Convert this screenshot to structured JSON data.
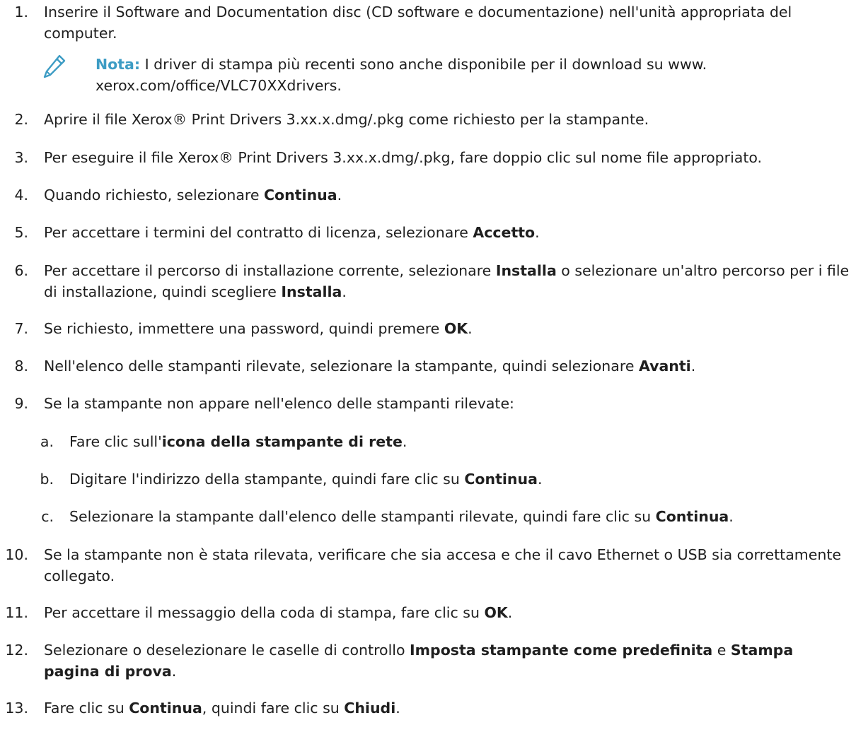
{
  "steps": [
    {
      "num": "1.",
      "text": "Inserire il Software and Documentation disc (CD software e documentazione) nell'unità appropriata del computer."
    },
    {
      "num": "2.",
      "text": "Aprire il file Xerox® Print Drivers 3.xx.x.dmg/.pkg come richiesto per la stampante."
    },
    {
      "num": "3.",
      "text": "Per eseguire il file Xerox® Print Drivers 3.xx.x.dmg/.pkg, fare doppio clic sul nome file appropriato."
    },
    {
      "num": "4.",
      "pre": "Quando richiesto, selezionare ",
      "b1": "Continua",
      "post": "."
    },
    {
      "num": "5.",
      "pre": "Per accettare i termini del contratto di licenza, selezionare ",
      "b1": "Accetto",
      "post": "."
    },
    {
      "num": "6.",
      "pre": "Per accettare il percorso di installazione corrente, selezionare ",
      "b1": "Installa",
      "mid": " o selezionare un'altro percorso per i file di installazione, quindi scegliere ",
      "b2": "Installa",
      "post": "."
    },
    {
      "num": "7.",
      "pre": "Se richiesto, immettere una password, quindi premere ",
      "b1": "OK",
      "post": "."
    },
    {
      "num": "8.",
      "pre": "Nell'elenco delle stampanti rilevate, selezionare la stampante, quindi selezionare ",
      "b1": "Avanti",
      "post": "."
    },
    {
      "num": "9.",
      "text": "Se la stampante non appare nell'elenco delle stampanti rilevate:"
    },
    {
      "num": "10.",
      "text": "Se la stampante non è stata rilevata, verificare che sia accesa e che il cavo Ethernet o USB sia correttamente collegato."
    },
    {
      "num": "11.",
      "pre": "Per accettare il messaggio della coda di stampa, fare clic su ",
      "b1": "OK",
      "post": "."
    },
    {
      "num": "12.",
      "pre": "Selezionare o deselezionare le caselle di controllo ",
      "b1": "Imposta stampante come predefinita",
      "mid": " e ",
      "b2": "Stampa pagina di prova",
      "post": "."
    },
    {
      "num": "13.",
      "pre": "Fare clic su ",
      "b1": "Continua",
      "mid": ", quindi fare clic su ",
      "b2": "Chiudi",
      "post": "."
    }
  ],
  "substeps": [
    {
      "num": "a.",
      "pre": "Fare clic sull'",
      "b1": "icona della stampante di rete",
      "post": "."
    },
    {
      "num": "b.",
      "pre": "Digitare l'indirizzo della stampante, quindi fare clic su ",
      "b1": "Continua",
      "post": "."
    },
    {
      "num": "c.",
      "pre": "Selezionare la stampante dall'elenco delle stampanti rilevate, quindi fare clic su ",
      "b1": "Continua",
      "post": "."
    }
  ],
  "note": {
    "label": "Nota:",
    "text": " I driver di stampa più recenti sono anche disponibile per il download su www. xerox.com/office/VLC70XXdrivers.",
    "icon": "pencil-icon",
    "label_color": "#3d9cc4"
  }
}
